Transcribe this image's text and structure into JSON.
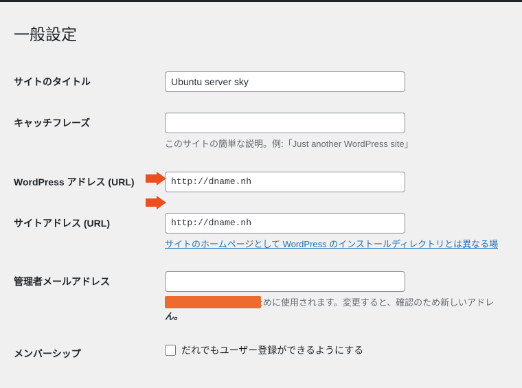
{
  "page": {
    "title": "一般設定"
  },
  "fields": {
    "site_title": {
      "label": "サイトのタイトル",
      "value": "Ubuntu server sky"
    },
    "tagline": {
      "label": "キャッチフレーズ",
      "value": "",
      "description": "このサイトの簡単な説明。例:「Just another WordPress site」"
    },
    "wp_url": {
      "label": "WordPress アドレス (URL)",
      "value": "http://dname.nh"
    },
    "site_url": {
      "label": "サイトアドレス (URL)",
      "value": "http://dname.nh",
      "help_link": "サイトのホームページとして WordPress のインストールディレクトリとは異なる場"
    },
    "admin_email": {
      "label": "管理者メールアドレス",
      "value": "",
      "description_prefix": "このアドレスは管理のために使用されます。変更すると、確認のため新しいアドレ",
      "description_strong": "ん。"
    },
    "membership": {
      "label": "メンバーシップ",
      "checkbox_label": "だれでもユーザー登録ができるようにする"
    }
  }
}
